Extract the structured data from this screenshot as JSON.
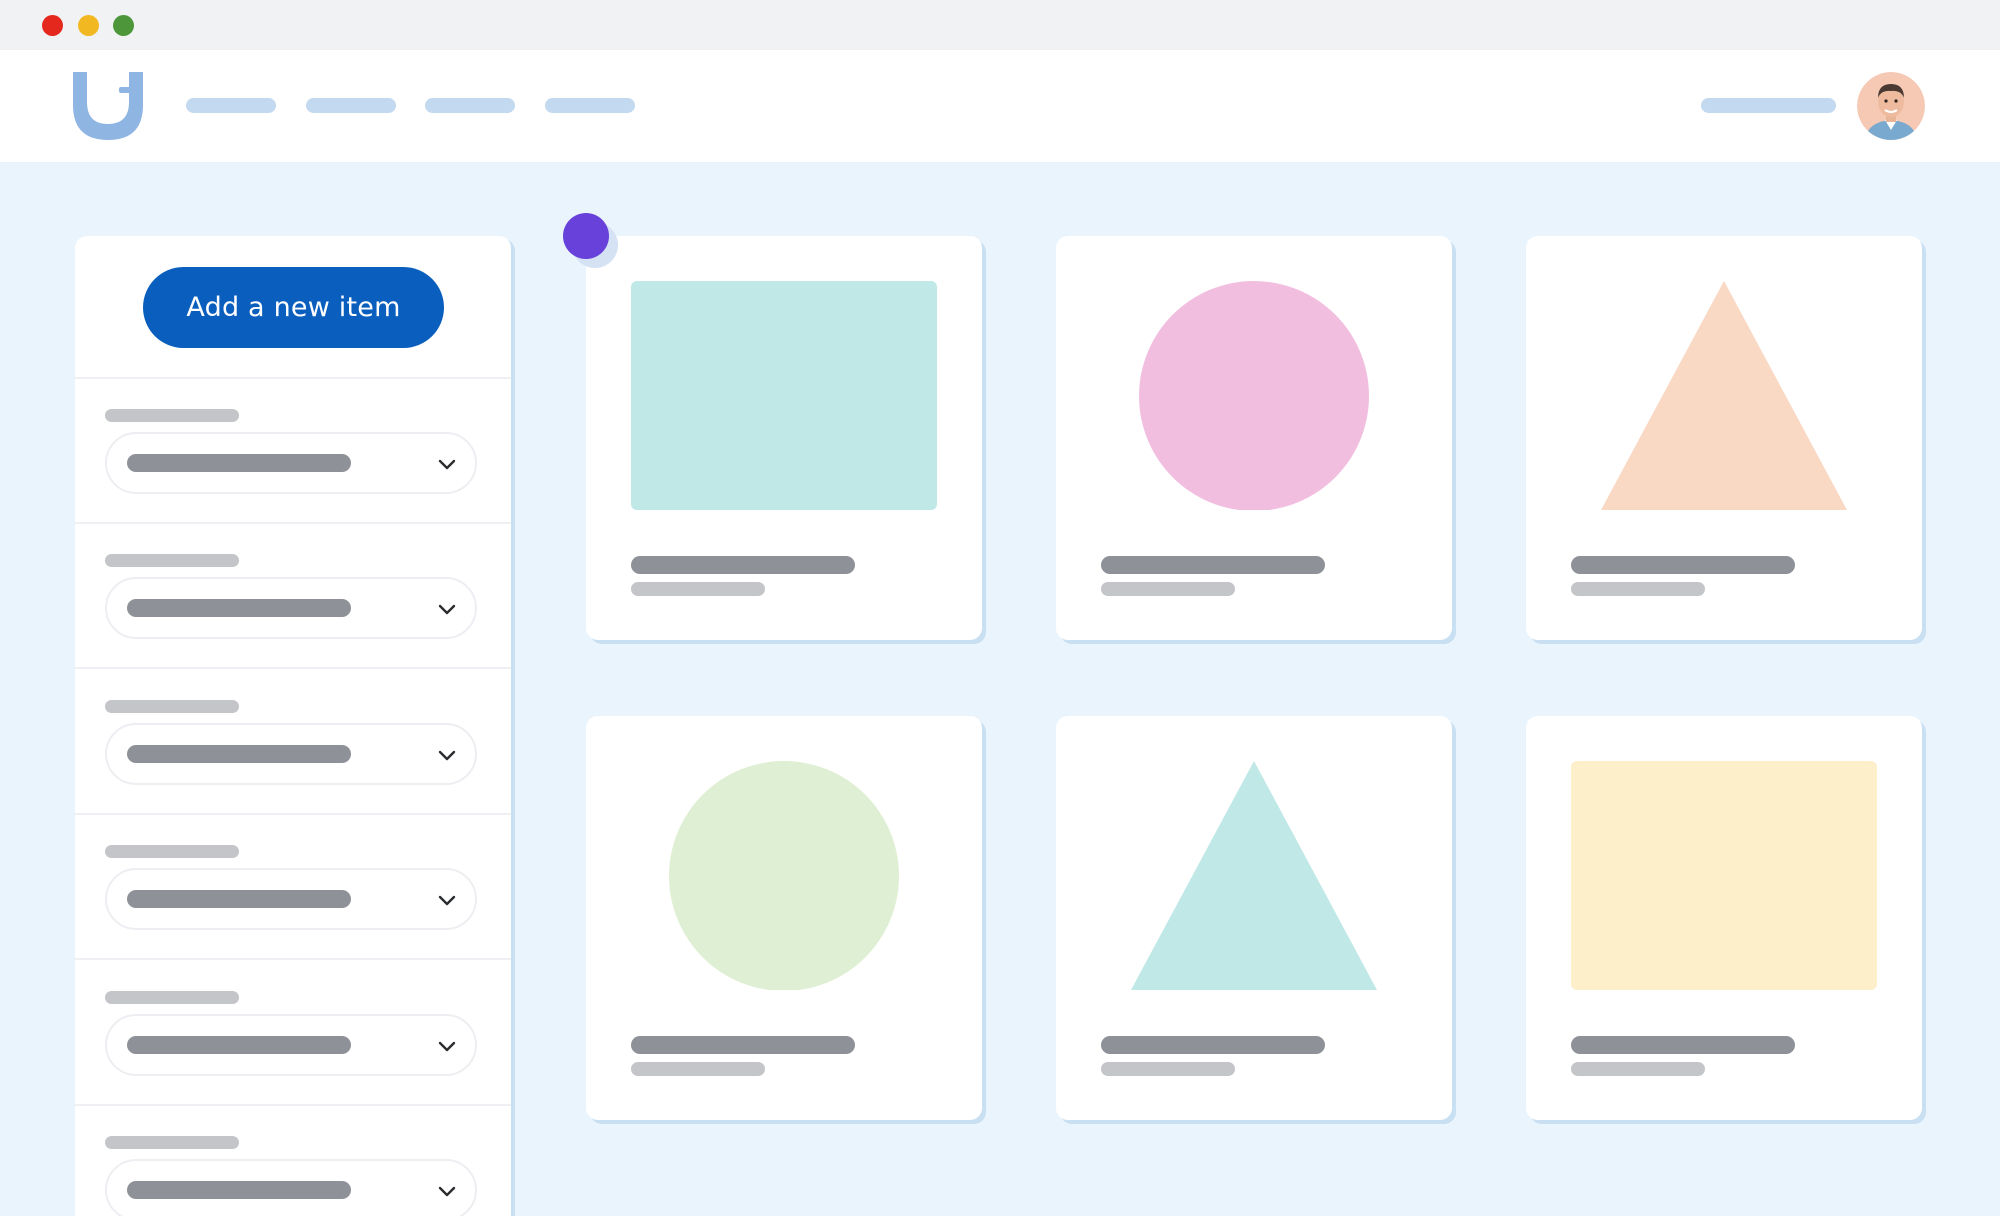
{
  "window": {
    "controls": [
      "close",
      "minimize",
      "zoom"
    ]
  },
  "header": {
    "logo_icon": "hand-logo-icon",
    "nav_items_count_visible": 4,
    "avatar_icon": "user-avatar"
  },
  "sidebar": {
    "add_button_label": "Add a new item",
    "filters": [
      {
        "chevron_icon": "chevron-down-icon"
      },
      {
        "chevron_icon": "chevron-down-icon"
      },
      {
        "chevron_icon": "chevron-down-icon"
      },
      {
        "chevron_icon": "chevron-down-icon"
      },
      {
        "chevron_icon": "chevron-down-icon"
      },
      {
        "chevron_icon": "chevron-down-icon"
      }
    ]
  },
  "cards": [
    {
      "shape": "rectangle",
      "color": "#bfe8e7"
    },
    {
      "shape": "circle",
      "color": "#f1bedf"
    },
    {
      "shape": "triangle",
      "color": "#fad9c4"
    },
    {
      "shape": "circle",
      "color": "#dfefd3"
    },
    {
      "shape": "triangle",
      "color": "#bfe8e7"
    },
    {
      "shape": "rectangle",
      "color": "#fdefc9"
    }
  ],
  "colors": {
    "accent": "#0a5ebd",
    "cursor": "#6741d9",
    "background": "#eaf4fd"
  }
}
